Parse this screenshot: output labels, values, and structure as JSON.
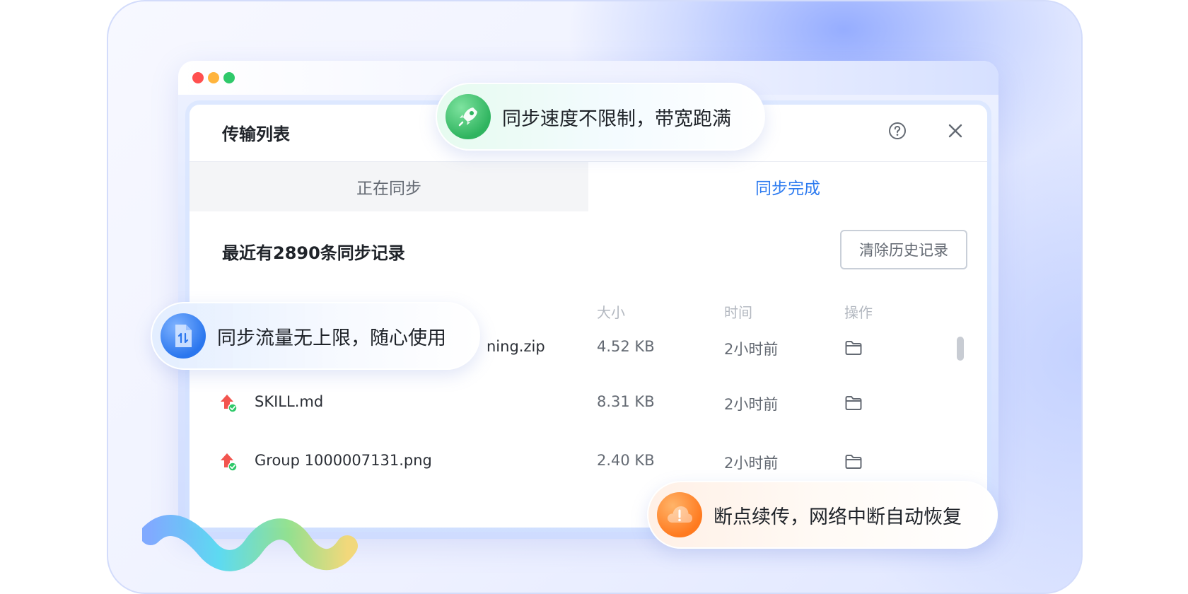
{
  "dialog": {
    "title": "传输列表",
    "help_icon": "question-circle-icon",
    "close_icon": "close-icon"
  },
  "tabs": [
    {
      "label": "正在同步",
      "active": false
    },
    {
      "label": "同步完成",
      "active": true
    }
  ],
  "records": {
    "title": "最近有2890条同步记录",
    "clear_label": "清除历史记录"
  },
  "columns": {
    "size": "大小",
    "time": "时间",
    "op": "操作"
  },
  "rows": [
    {
      "name": "ning.zip",
      "size": "4.52 KB",
      "time": "2小时前"
    },
    {
      "name": "SKILL.md",
      "size": "8.31 KB",
      "time": "2小时前"
    },
    {
      "name": "Group 1000007131.png",
      "size": "2.40 KB",
      "time": "2小时前"
    }
  ],
  "pills": {
    "speed": "同步速度不限制，带宽跑满",
    "traffic": "同步流量无上限，随心使用",
    "resume": "断点续传，网络中断自动恢复"
  },
  "colors": {
    "accent": "#2d7bf0",
    "green": "#2fb45f",
    "blue": "#2a76ee",
    "orange": "#ff7a1f"
  }
}
